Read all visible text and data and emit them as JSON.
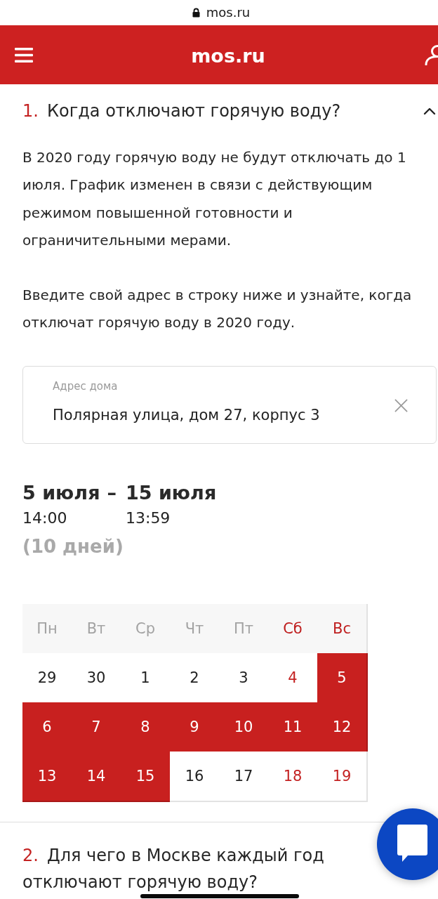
{
  "url_bar": {
    "secure": true,
    "address": "mos.ru"
  },
  "header": {
    "title": "mos.ru"
  },
  "sections": [
    {
      "number": "1.",
      "title": "Когда отключают горячую воду?",
      "expanded": true,
      "paragraphs": [
        "В 2020 году горячую воду не будут отключать до 1 июля. График изменен в связи с действующим режимом повышенной готовности и ограничительными мерами.",
        "Введите свой адрес в строку ниже и узнайте, когда отключат горячую воду в 2020 году."
      ],
      "address_field": {
        "label": "Адрес дома",
        "value": "Полярная улица, дом 27, корпус 3"
      },
      "outage_period": {
        "start": {
          "date": "5 июля",
          "time": "14:00"
        },
        "separator": "–",
        "end": {
          "date": "15 июля",
          "time": "13:59"
        },
        "duration": "(10 дней)"
      },
      "calendar": {
        "weekdays": [
          {
            "label": "Пн",
            "weekend": false
          },
          {
            "label": "Вт",
            "weekend": false
          },
          {
            "label": "Ср",
            "weekend": false
          },
          {
            "label": "Чт",
            "weekend": false
          },
          {
            "label": "Пт",
            "weekend": false
          },
          {
            "label": "Сб",
            "weekend": true
          },
          {
            "label": "Вс",
            "weekend": true
          }
        ],
        "weeks": [
          [
            {
              "day": "29",
              "weekend": false,
              "outage": false
            },
            {
              "day": "30",
              "weekend": false,
              "outage": false
            },
            {
              "day": "1",
              "weekend": false,
              "outage": false
            },
            {
              "day": "2",
              "weekend": false,
              "outage": false
            },
            {
              "day": "3",
              "weekend": false,
              "outage": false
            },
            {
              "day": "4",
              "weekend": true,
              "outage": false
            },
            {
              "day": "5",
              "outage": true
            }
          ],
          [
            {
              "day": "6",
              "outage": true
            },
            {
              "day": "7",
              "outage": true
            },
            {
              "day": "8",
              "outage": true
            },
            {
              "day": "9",
              "outage": true
            },
            {
              "day": "10",
              "outage": true
            },
            {
              "day": "11",
              "outage": true
            },
            {
              "day": "12",
              "outage": true
            }
          ],
          [
            {
              "day": "13",
              "outage": true
            },
            {
              "day": "14",
              "outage": true
            },
            {
              "day": "15",
              "outage": true
            },
            {
              "day": "16",
              "weekend": false,
              "outage": false
            },
            {
              "day": "17",
              "weekend": false,
              "outage": false
            },
            {
              "day": "18",
              "weekend": true,
              "outage": false
            },
            {
              "day": "19",
              "weekend": true,
              "outage": false
            }
          ]
        ]
      }
    },
    {
      "number": "2.",
      "title": "Для чего в Москве каждый год отключают горячую воду?"
    }
  ]
}
